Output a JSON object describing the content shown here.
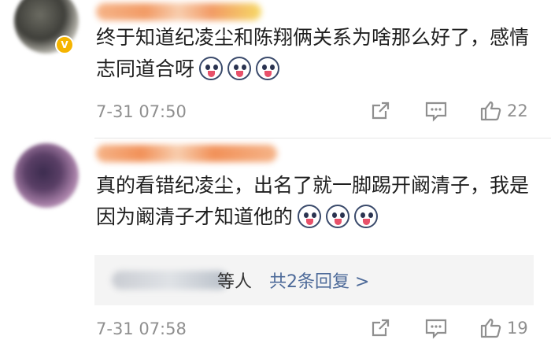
{
  "comments": [
    {
      "text": "终于知道纪凌尘和陈翔俩关系为啥那么好了，感情志同道合呀",
      "emoji_count": 3,
      "verified_badge": "V",
      "time": "7-31 07:50",
      "like_count": "22"
    },
    {
      "text": "真的看错纪凌尘，出名了就一脚踢开阚清子，我是因为阚清子才知道他的",
      "emoji_count": 3,
      "reply_summary": {
        "who_suffix": "等人",
        "link": "共2条回复 >"
      },
      "time": "7-31 07:58",
      "like_count": "19"
    }
  ],
  "icons": {
    "share": "share-icon",
    "comment": "comment-icon",
    "like": "thumbs-up-icon"
  },
  "colors": {
    "link": "#4d6a99",
    "meta": "#8f8f8f",
    "badge": "#f5b400"
  }
}
